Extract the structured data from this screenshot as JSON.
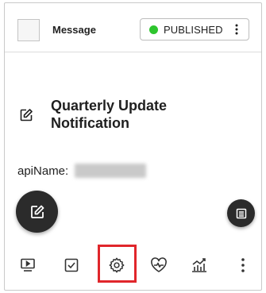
{
  "header": {
    "message_label": "Message",
    "status": {
      "label": "PUBLISHED",
      "color": "#2ec52e"
    }
  },
  "content": {
    "title": "Quarterly Update Notification",
    "api_label": "apiName:"
  },
  "toolbar": {
    "items": [
      {
        "icon": "preview-icon"
      },
      {
        "icon": "checkbox-icon"
      },
      {
        "icon": "settings-gear-icon",
        "highlighted": true
      },
      {
        "icon": "health-heart-icon"
      },
      {
        "icon": "analytics-chart-icon"
      },
      {
        "icon": "more-vertical-icon"
      }
    ],
    "highlight_color": "#e0262b"
  }
}
